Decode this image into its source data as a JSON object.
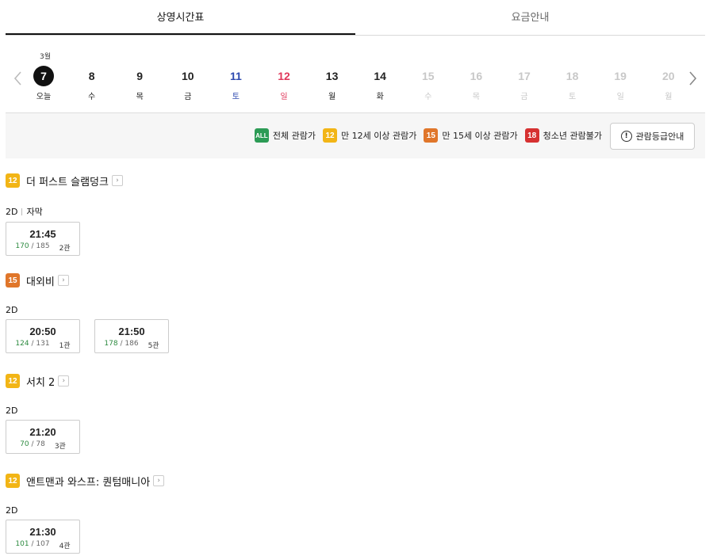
{
  "tabs": [
    {
      "label": "상영시간표",
      "active": true
    },
    {
      "label": "요금안내",
      "active": false
    }
  ],
  "calendar": {
    "month": "3월",
    "days": [
      {
        "num": "7",
        "wd": "오늘",
        "state": "selected"
      },
      {
        "num": "8",
        "wd": "수",
        "state": "normal"
      },
      {
        "num": "9",
        "wd": "목",
        "state": "normal"
      },
      {
        "num": "10",
        "wd": "금",
        "state": "normal"
      },
      {
        "num": "11",
        "wd": "토",
        "state": "sat"
      },
      {
        "num": "12",
        "wd": "일",
        "state": "sun"
      },
      {
        "num": "13",
        "wd": "월",
        "state": "normal"
      },
      {
        "num": "14",
        "wd": "화",
        "state": "normal"
      },
      {
        "num": "15",
        "wd": "수",
        "state": "disabled"
      },
      {
        "num": "16",
        "wd": "목",
        "state": "disabled"
      },
      {
        "num": "17",
        "wd": "금",
        "state": "disabled"
      },
      {
        "num": "18",
        "wd": "토",
        "state": "disabled"
      },
      {
        "num": "19",
        "wd": "일",
        "state": "disabled"
      },
      {
        "num": "20",
        "wd": "월",
        "state": "disabled"
      }
    ]
  },
  "legend": {
    "items": [
      {
        "badge": "ALL",
        "cls": "all",
        "label": "전체 관람가"
      },
      {
        "badge": "12",
        "cls": "r12",
        "label": "만 12세 이상 관람가"
      },
      {
        "badge": "15",
        "cls": "r15",
        "label": "만 15세 이상 관람가"
      },
      {
        "badge": "18",
        "cls": "r18",
        "label": "청소년 관람불가"
      }
    ],
    "guide_button": "관람등급안내"
  },
  "colors": {
    "all": "#2c9b55",
    "r12": "#f2b516",
    "r15": "#e0762a",
    "r18": "#d63131",
    "saturday": "#2f4bb0",
    "sunday": "#e0385b",
    "remaining": "#2c8a3f"
  },
  "movies": [
    {
      "rating": "12",
      "rating_cls": "r12",
      "title": "더 퍼스트 슬램덩크",
      "format": "2D",
      "subtitle": "자막",
      "showtimes": [
        {
          "time": "21:45",
          "remain": "170",
          "total": "185",
          "hall": "2관"
        }
      ]
    },
    {
      "rating": "15",
      "rating_cls": "r15",
      "title": "대외비",
      "format": "2D",
      "subtitle": "",
      "showtimes": [
        {
          "time": "20:50",
          "remain": "124",
          "total": "131",
          "hall": "1관"
        },
        {
          "time": "21:50",
          "remain": "178",
          "total": "186",
          "hall": "5관"
        }
      ]
    },
    {
      "rating": "12",
      "rating_cls": "r12",
      "title": "서치 2",
      "format": "2D",
      "subtitle": "",
      "showtimes": [
        {
          "time": "21:20",
          "remain": "70",
          "total": "78",
          "hall": "3관"
        }
      ]
    },
    {
      "rating": "12",
      "rating_cls": "r12",
      "title": "앤트맨과 와스프: 퀀텀매니아",
      "format": "2D",
      "subtitle": "",
      "showtimes": [
        {
          "time": "21:30",
          "remain": "101",
          "total": "107",
          "hall": "4관"
        }
      ]
    }
  ]
}
